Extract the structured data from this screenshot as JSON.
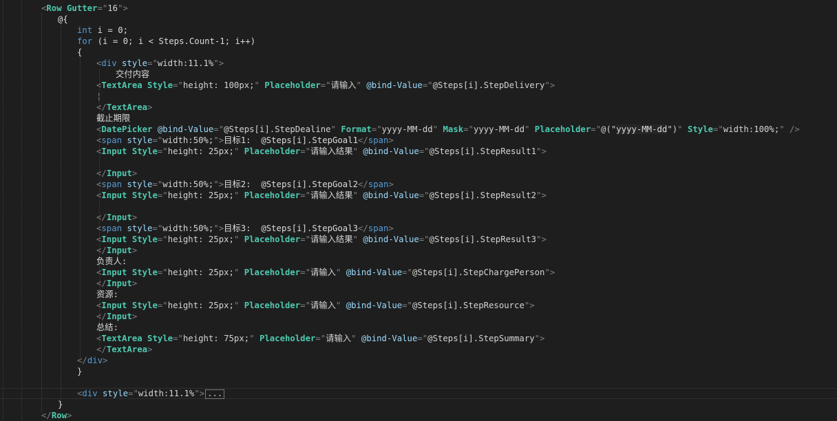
{
  "editor": {
    "lines": [
      {
        "indent": 60,
        "tokens": [
          [
            "p",
            "<"
          ],
          [
            "ctg",
            "Row"
          ],
          [
            "v",
            " "
          ],
          [
            "cat",
            "Gutter"
          ],
          [
            "p",
            "=\""
          ],
          [
            "v",
            "16"
          ],
          [
            "p",
            "\">"
          ]
        ]
      },
      {
        "indent": 84,
        "tokens": [
          [
            "rzm",
            "@{"
          ]
        ]
      },
      {
        "indent": 112,
        "tokens": [
          [
            "kw",
            "int"
          ],
          [
            "tx",
            " i = 0;"
          ]
        ]
      },
      {
        "indent": 112,
        "tokens": [
          [
            "kw",
            "for"
          ],
          [
            "tx",
            " (i = 0; i < Steps.Count-1; i++)"
          ]
        ]
      },
      {
        "indent": 112,
        "tokens": [
          [
            "tx",
            "{"
          ]
        ]
      },
      {
        "indent": 140,
        "tokens": [
          [
            "p",
            "<"
          ],
          [
            "tg",
            "div"
          ],
          [
            "v",
            " "
          ],
          [
            "at",
            "style"
          ],
          [
            "p",
            "=\""
          ],
          [
            "v",
            "width:11.1%"
          ],
          [
            "p",
            "\">"
          ]
        ]
      },
      {
        "indent": 168,
        "tokens": [
          [
            "tx",
            "交付内容"
          ]
        ]
      },
      {
        "indent": 140,
        "tokens": [
          [
            "p",
            "<"
          ],
          [
            "ctg",
            "TextArea"
          ],
          [
            "v",
            " "
          ],
          [
            "cat",
            "Style"
          ],
          [
            "p",
            "=\""
          ],
          [
            "v",
            "height: 100px;"
          ],
          [
            "p",
            "\""
          ],
          [
            "v",
            " "
          ],
          [
            "cat",
            "Placeholder"
          ],
          [
            "p",
            "=\""
          ],
          [
            "v",
            "请输入"
          ],
          [
            "p",
            "\""
          ],
          [
            "v",
            " "
          ],
          [
            "at",
            "@bind-Value"
          ],
          [
            "p",
            "=\""
          ],
          [
            "v",
            "@Steps[i].StepDelivery"
          ],
          [
            "p",
            "\">"
          ]
        ]
      },
      {
        "indent": 140,
        "tokens": [
          [
            "p",
            "¦"
          ]
        ]
      },
      {
        "indent": 140,
        "tokens": [
          [
            "p",
            "</"
          ],
          [
            "ctg",
            "TextArea"
          ],
          [
            "p",
            ">"
          ]
        ]
      },
      {
        "indent": 140,
        "tokens": [
          [
            "tx",
            "截止期限"
          ]
        ]
      },
      {
        "indent": 140,
        "tokens": [
          [
            "p",
            "<"
          ],
          [
            "ctg",
            "DatePicker"
          ],
          [
            "v",
            " "
          ],
          [
            "at",
            "@bind-Value"
          ],
          [
            "p",
            "=\""
          ],
          [
            "v",
            "@Steps[i].StepDealine"
          ],
          [
            "p",
            "\""
          ],
          [
            "v",
            " "
          ],
          [
            "cat",
            "Format"
          ],
          [
            "p",
            "=\""
          ],
          [
            "v",
            "yyyy-MM-dd"
          ],
          [
            "p",
            "\""
          ],
          [
            "v",
            " "
          ],
          [
            "cat",
            "Mask"
          ],
          [
            "p",
            "=\""
          ],
          [
            "v",
            "yyyy-MM-dd"
          ],
          [
            "p",
            "\""
          ],
          [
            "v",
            " "
          ],
          [
            "cat",
            "Placeholder"
          ],
          [
            "p",
            "=\""
          ],
          [
            "v",
            "@(\""
          ],
          [
            "rz",
            "yyyy-MM-dd"
          ],
          [
            "v",
            "\")"
          ],
          [
            "p",
            "\""
          ],
          [
            "v",
            " "
          ],
          [
            "cat",
            "Style"
          ],
          [
            "p",
            "=\""
          ],
          [
            "v",
            "width:100%;"
          ],
          [
            "p",
            "\" />"
          ]
        ]
      },
      {
        "indent": 140,
        "tokens": [
          [
            "p",
            "<"
          ],
          [
            "tg",
            "span"
          ],
          [
            "v",
            " "
          ],
          [
            "at",
            "style"
          ],
          [
            "p",
            "=\""
          ],
          [
            "v",
            "width:50%;"
          ],
          [
            "p",
            "\">"
          ],
          [
            "tx",
            "目标1:  @Steps[i].StepGoal1"
          ],
          [
            "p",
            "</"
          ],
          [
            "tg",
            "span"
          ],
          [
            "p",
            ">"
          ]
        ]
      },
      {
        "indent": 140,
        "tokens": [
          [
            "p",
            "<"
          ],
          [
            "ctg",
            "Input"
          ],
          [
            "v",
            " "
          ],
          [
            "cat",
            "Style"
          ],
          [
            "p",
            "=\""
          ],
          [
            "v",
            "height: 25px;"
          ],
          [
            "p",
            "\""
          ],
          [
            "v",
            " "
          ],
          [
            "cat",
            "Placeholder"
          ],
          [
            "p",
            "=\""
          ],
          [
            "v",
            "请输入结果"
          ],
          [
            "p",
            "\""
          ],
          [
            "v",
            " "
          ],
          [
            "at",
            "@bind-Value"
          ],
          [
            "p",
            "=\""
          ],
          [
            "v",
            "@Steps[i].StepResult1"
          ],
          [
            "p",
            "\">"
          ]
        ]
      },
      {
        "indent": 140,
        "tokens": []
      },
      {
        "indent": 140,
        "tokens": [
          [
            "p",
            "</"
          ],
          [
            "ctg",
            "Input"
          ],
          [
            "p",
            ">"
          ]
        ]
      },
      {
        "indent": 140,
        "tokens": [
          [
            "p",
            "<"
          ],
          [
            "tg",
            "span"
          ],
          [
            "v",
            " "
          ],
          [
            "at",
            "style"
          ],
          [
            "p",
            "=\""
          ],
          [
            "v",
            "width:50%;"
          ],
          [
            "p",
            "\">"
          ],
          [
            "tx",
            "目标2:  @Steps[i].StepGoal2"
          ],
          [
            "p",
            "</"
          ],
          [
            "tg",
            "span"
          ],
          [
            "p",
            ">"
          ]
        ]
      },
      {
        "indent": 140,
        "tokens": [
          [
            "p",
            "<"
          ],
          [
            "ctg",
            "Input"
          ],
          [
            "v",
            " "
          ],
          [
            "cat",
            "Style"
          ],
          [
            "p",
            "=\""
          ],
          [
            "v",
            "height: 25px;"
          ],
          [
            "p",
            "\""
          ],
          [
            "v",
            " "
          ],
          [
            "cat",
            "Placeholder"
          ],
          [
            "p",
            "=\""
          ],
          [
            "v",
            "请输入结果"
          ],
          [
            "p",
            "\""
          ],
          [
            "v",
            " "
          ],
          [
            "at",
            "@bind-Value"
          ],
          [
            "p",
            "=\""
          ],
          [
            "v",
            "@Steps[i].StepResult2"
          ],
          [
            "p",
            "\">"
          ]
        ]
      },
      {
        "indent": 140,
        "tokens": []
      },
      {
        "indent": 140,
        "tokens": [
          [
            "p",
            "</"
          ],
          [
            "ctg",
            "Input"
          ],
          [
            "p",
            ">"
          ]
        ]
      },
      {
        "indent": 140,
        "tokens": [
          [
            "p",
            "<"
          ],
          [
            "tg",
            "span"
          ],
          [
            "v",
            " "
          ],
          [
            "at",
            "style"
          ],
          [
            "p",
            "=\""
          ],
          [
            "v",
            "width:50%;"
          ],
          [
            "p",
            "\">"
          ],
          [
            "tx",
            "目标3:  @Steps[i].StepGoal3"
          ],
          [
            "p",
            "</"
          ],
          [
            "tg",
            "span"
          ],
          [
            "p",
            ">"
          ]
        ]
      },
      {
        "indent": 140,
        "tokens": [
          [
            "p",
            "<"
          ],
          [
            "ctg",
            "Input"
          ],
          [
            "v",
            " "
          ],
          [
            "cat",
            "Style"
          ],
          [
            "p",
            "=\""
          ],
          [
            "v",
            "height: 25px;"
          ],
          [
            "p",
            "\""
          ],
          [
            "v",
            " "
          ],
          [
            "cat",
            "Placeholder"
          ],
          [
            "p",
            "=\""
          ],
          [
            "v",
            "请输入结果"
          ],
          [
            "p",
            "\""
          ],
          [
            "v",
            " "
          ],
          [
            "at",
            "@bind-Value"
          ],
          [
            "p",
            "=\""
          ],
          [
            "v",
            "@Steps[i].StepResult3"
          ],
          [
            "p",
            "\">"
          ]
        ]
      },
      {
        "indent": 140,
        "tokens": [
          [
            "p",
            "</"
          ],
          [
            "ctg",
            "Input"
          ],
          [
            "p",
            ">"
          ]
        ]
      },
      {
        "indent": 140,
        "tokens": [
          [
            "tx",
            "负责人:"
          ]
        ]
      },
      {
        "indent": 140,
        "tokens": [
          [
            "p",
            "<"
          ],
          [
            "ctg",
            "Input"
          ],
          [
            "v",
            " "
          ],
          [
            "cat",
            "Style"
          ],
          [
            "p",
            "=\""
          ],
          [
            "v",
            "height: 25px;"
          ],
          [
            "p",
            "\""
          ],
          [
            "v",
            " "
          ],
          [
            "cat",
            "Placeholder"
          ],
          [
            "p",
            "=\""
          ],
          [
            "v",
            "请输入"
          ],
          [
            "p",
            "\""
          ],
          [
            "v",
            " "
          ],
          [
            "at",
            "@bind-Value"
          ],
          [
            "p",
            "=\""
          ],
          [
            "v",
            "@Steps[i].StepChargePerson"
          ],
          [
            "p",
            "\">"
          ]
        ]
      },
      {
        "indent": 140,
        "tokens": [
          [
            "p",
            "</"
          ],
          [
            "ctg",
            "Input"
          ],
          [
            "p",
            ">"
          ]
        ]
      },
      {
        "indent": 140,
        "tokens": [
          [
            "tx",
            "资源:"
          ]
        ]
      },
      {
        "indent": 140,
        "tokens": [
          [
            "p",
            "<"
          ],
          [
            "ctg",
            "Input"
          ],
          [
            "v",
            " "
          ],
          [
            "cat",
            "Style"
          ],
          [
            "p",
            "=\""
          ],
          [
            "v",
            "height: 25px;"
          ],
          [
            "p",
            "\""
          ],
          [
            "v",
            " "
          ],
          [
            "cat",
            "Placeholder"
          ],
          [
            "p",
            "=\""
          ],
          [
            "v",
            "请输入"
          ],
          [
            "p",
            "\""
          ],
          [
            "v",
            " "
          ],
          [
            "at",
            "@bind-Value"
          ],
          [
            "p",
            "=\""
          ],
          [
            "v",
            "@Steps[i].StepResource"
          ],
          [
            "p",
            "\">"
          ]
        ]
      },
      {
        "indent": 140,
        "tokens": [
          [
            "p",
            "</"
          ],
          [
            "ctg",
            "Input"
          ],
          [
            "p",
            ">"
          ]
        ]
      },
      {
        "indent": 140,
        "tokens": [
          [
            "tx",
            "总结:"
          ]
        ]
      },
      {
        "indent": 140,
        "tokens": [
          [
            "p",
            "<"
          ],
          [
            "ctg",
            "TextArea"
          ],
          [
            "v",
            " "
          ],
          [
            "cat",
            "Style"
          ],
          [
            "p",
            "=\""
          ],
          [
            "v",
            "height: 75px;"
          ],
          [
            "p",
            "\""
          ],
          [
            "v",
            " "
          ],
          [
            "cat",
            "Placeholder"
          ],
          [
            "p",
            "=\""
          ],
          [
            "v",
            "请输入"
          ],
          [
            "p",
            "\""
          ],
          [
            "v",
            " "
          ],
          [
            "at",
            "@bind-Value"
          ],
          [
            "p",
            "=\""
          ],
          [
            "v",
            "@Steps[i].StepSummary"
          ],
          [
            "p",
            "\">"
          ]
        ]
      },
      {
        "indent": 140,
        "tokens": [
          [
            "p",
            "</"
          ],
          [
            "ctg",
            "TextArea"
          ],
          [
            "p",
            ">"
          ]
        ]
      },
      {
        "indent": 112,
        "tokens": [
          [
            "p",
            "</"
          ],
          [
            "tg",
            "div"
          ],
          [
            "p",
            ">"
          ]
        ]
      },
      {
        "indent": 112,
        "tokens": [
          [
            "tx",
            "}"
          ]
        ]
      },
      {
        "indent": 112,
        "tokens": []
      },
      {
        "indent": 112,
        "current": true,
        "tokens": [
          [
            "p",
            "<"
          ],
          [
            "tg",
            "div"
          ],
          [
            "v",
            " "
          ],
          [
            "at",
            "style"
          ],
          [
            "p",
            "=\""
          ],
          [
            "v",
            "width:11.1%"
          ],
          [
            "p",
            "\">"
          ]
        ],
        "fold": "..."
      },
      {
        "indent": 84,
        "tokens": [
          [
            "rzm",
            "}"
          ]
        ]
      },
      {
        "indent": 60,
        "tokens": [
          [
            "p",
            "</"
          ],
          [
            "ctg",
            "Row"
          ],
          [
            "p",
            ">"
          ]
        ]
      }
    ]
  }
}
